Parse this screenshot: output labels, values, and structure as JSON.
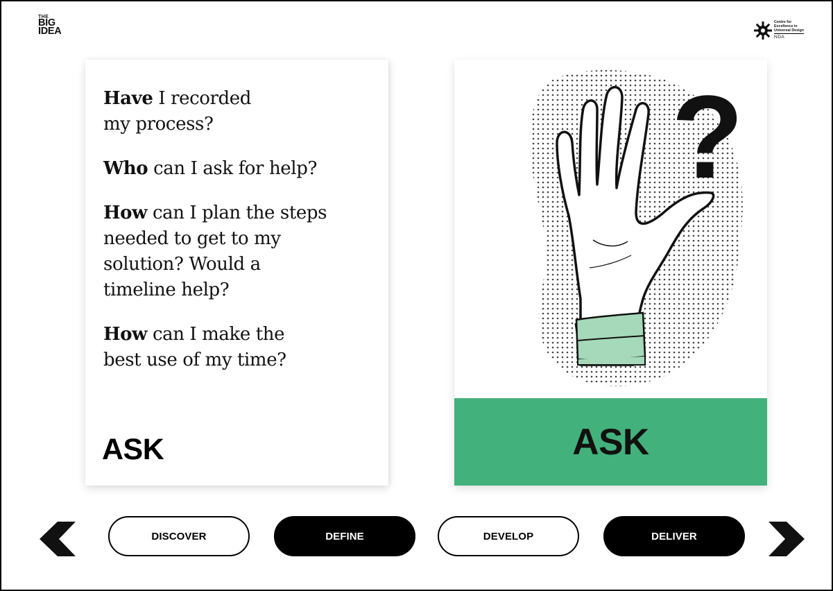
{
  "brand": {
    "logo_line1": "THE",
    "logo_line2": "BIG",
    "logo_line3": "IDEA",
    "partner_line1": "Centre for",
    "partner_line2": "Excellence in",
    "partner_line3": "Universal Design",
    "partner_org": "NDA"
  },
  "card": {
    "questions": [
      {
        "bold": "Have",
        "rest": " I recorded my process?"
      },
      {
        "bold": "Who",
        "rest": " can I ask for help?"
      },
      {
        "bold": "How",
        "rest": " can I plan the steps needed to get to my solution? Would a timeline help?"
      },
      {
        "bold": "How",
        "rest": " can I make the best use of my time?"
      }
    ],
    "label": "ASK",
    "banner_label": "ASK",
    "illustration_icon": "raised-hand-question-icon",
    "question_glyph": "?"
  },
  "nav": {
    "prev_icon": "chevron-left-icon",
    "next_icon": "chevron-right-icon",
    "steps": [
      {
        "label": "DISCOVER",
        "style": "outline"
      },
      {
        "label": "DEFINE",
        "style": "filled"
      },
      {
        "label": "DEVELOP",
        "style": "outline"
      },
      {
        "label": "DELIVER",
        "style": "filled"
      }
    ]
  },
  "colors": {
    "accent_green": "#43b17b",
    "sleeve_green": "#a5d9b9",
    "ink": "#111111"
  }
}
